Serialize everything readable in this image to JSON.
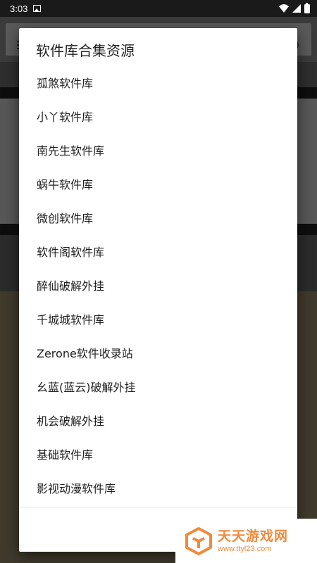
{
  "status_bar": {
    "time": "3:03"
  },
  "dialog": {
    "title": "软件库合集资源",
    "items": [
      "孤煞软件库",
      "小丫软件库",
      "南先生软件库",
      "蜗牛软件库",
      "微创软件库",
      "软件阁软件库",
      "醉仙破解外挂",
      "千城城软件库",
      "Zerone软件收录站",
      "幺蓝(蓝云)破解外挂",
      "机会破解外挂",
      "基础软件库",
      "影视动漫软件库"
    ]
  },
  "watermark": {
    "name": "天天游戏网",
    "url": "www.ttyl23.com"
  },
  "colors": {
    "watermark_orange": "#f08a3c",
    "scrim": "#2a2a2a",
    "dialog_bg": "#ffffff"
  }
}
